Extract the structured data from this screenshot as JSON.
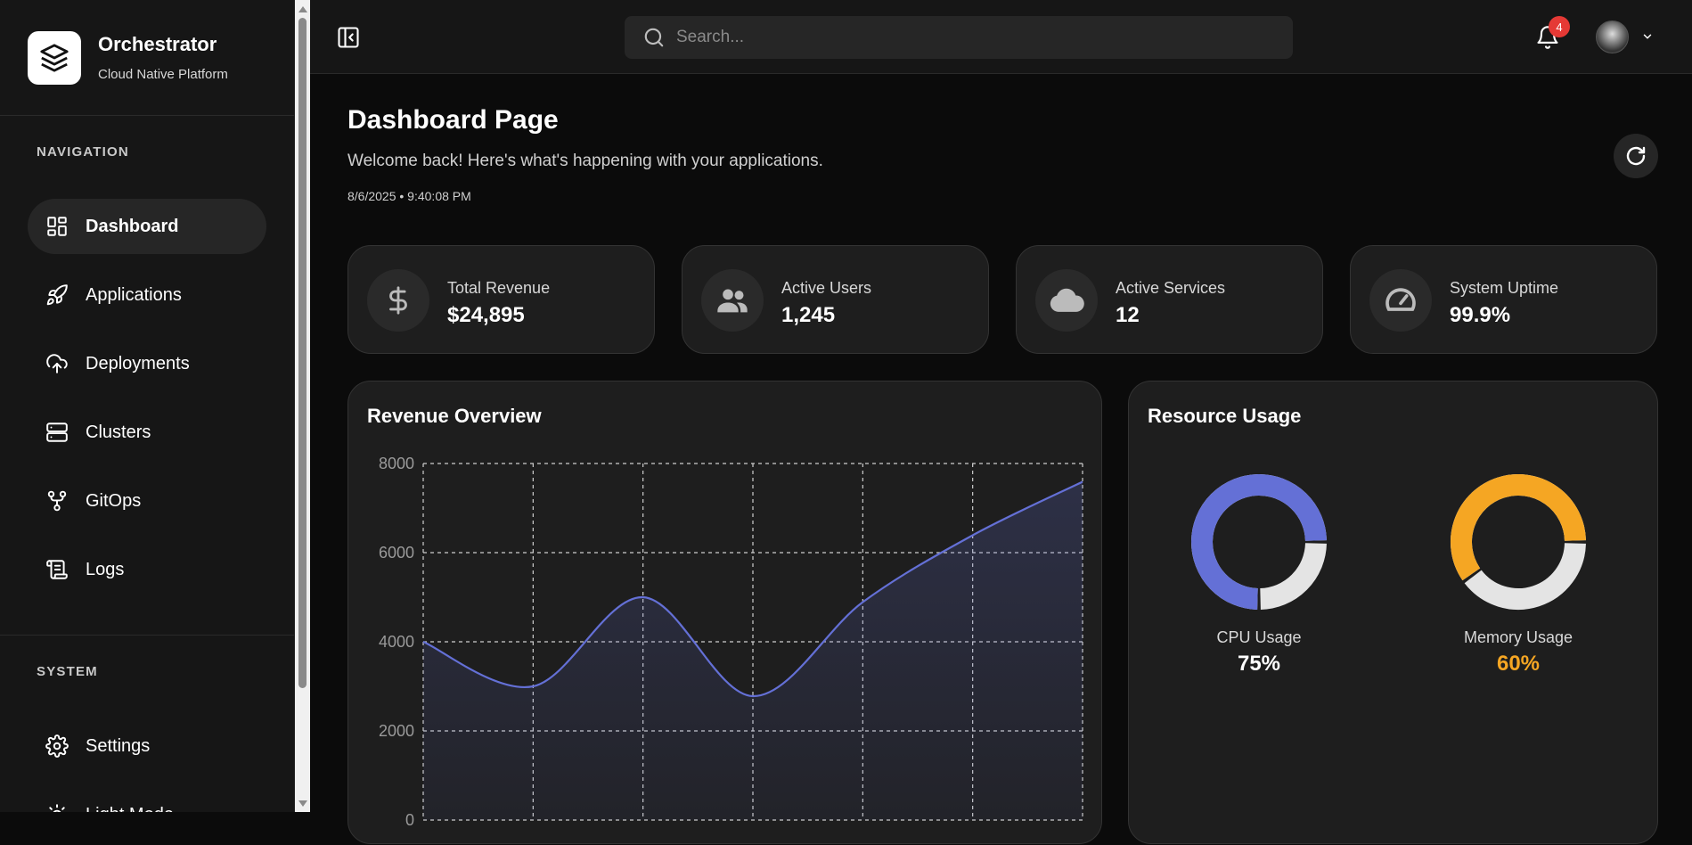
{
  "brand": {
    "title": "Orchestrator",
    "subtitle": "Cloud Native Platform"
  },
  "sidebar": {
    "nav_heading": "NAVIGATION",
    "items": [
      {
        "label": "Dashboard",
        "icon": "dashboard-icon",
        "active": true
      },
      {
        "label": "Applications",
        "icon": "rocket-icon"
      },
      {
        "label": "Deployments",
        "icon": "cloud-upload-icon"
      },
      {
        "label": "Clusters",
        "icon": "server-icon"
      },
      {
        "label": "GitOps",
        "icon": "git-branch-icon"
      },
      {
        "label": "Logs",
        "icon": "scroll-icon"
      }
    ],
    "system_heading": "SYSTEM",
    "system_items": [
      {
        "label": "Settings",
        "icon": "gear-icon"
      },
      {
        "label": "Light Mode",
        "icon": "sun-icon"
      }
    ]
  },
  "topbar": {
    "search_placeholder": "Search...",
    "notification_count": "4"
  },
  "page": {
    "title": "Dashboard Page",
    "subtitle": "Welcome back! Here's what's happening with your applications.",
    "timestamp": "8/6/2025 • 9:40:08 PM"
  },
  "stats": [
    {
      "label": "Total Revenue",
      "value": "$24,895",
      "icon": "dollar-icon"
    },
    {
      "label": "Active Users",
      "value": "1,245",
      "icon": "users-icon"
    },
    {
      "label": "Active Services",
      "value": "12",
      "icon": "cloud-icon"
    },
    {
      "label": "System Uptime",
      "value": "99.9%",
      "icon": "speedometer-icon"
    }
  ],
  "revenue_panel": {
    "title": "Revenue Overview"
  },
  "resource_panel": {
    "title": "Resource Usage",
    "cpu": {
      "label": "CPU Usage",
      "value": "75%",
      "fraction": 0.75,
      "color": "#6470d6"
    },
    "memory": {
      "label": "Memory Usage",
      "value": "60%",
      "fraction": 0.6,
      "color": "#f5a623"
    }
  },
  "colors": {
    "accent": "#6470d6",
    "memory": "#f5a623",
    "badge": "#e53935"
  },
  "chart_data": {
    "type": "area",
    "x": [
      0,
      1,
      2,
      3,
      4,
      5,
      6
    ],
    "values": [
      4000,
      3000,
      5000,
      2780,
      4890,
      6390,
      7590
    ],
    "ylim": [
      0,
      8000
    ],
    "yticks": [
      "8000",
      "6000",
      "4000",
      "2000",
      "0"
    ],
    "grid": true,
    "color": "#6470d6"
  }
}
